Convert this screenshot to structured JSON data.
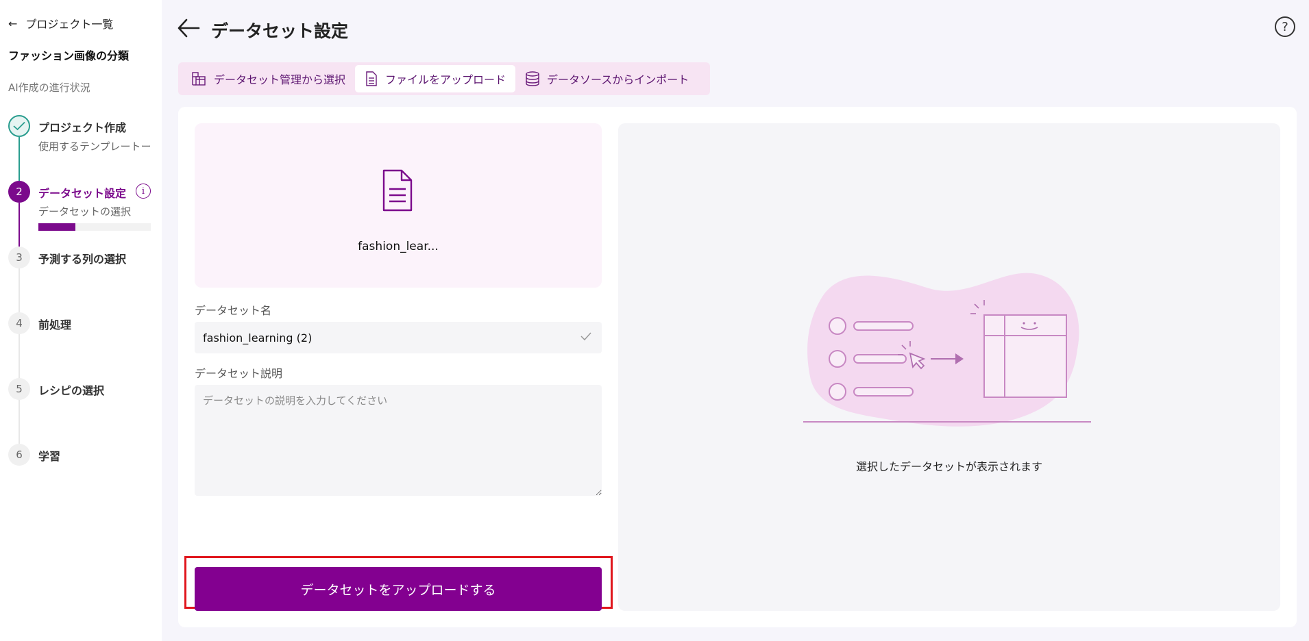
{
  "sidebar": {
    "back_label": "プロジェクト一覧",
    "project_name": "ファッション画像の分類",
    "progress_title": "AI作成の進行状況",
    "steps": [
      {
        "number": "",
        "label": "プロジェクト作成",
        "sub": "使用するテンプレートー",
        "state": "done"
      },
      {
        "number": "2",
        "label": "データセット設定",
        "sub": "データセットの選択",
        "state": "active",
        "progress": 0.33
      },
      {
        "number": "3",
        "label": "予測する列の選択",
        "state": "todo"
      },
      {
        "number": "4",
        "label": "前処理",
        "state": "todo"
      },
      {
        "number": "5",
        "label": "レシピの選択",
        "state": "todo"
      },
      {
        "number": "6",
        "label": "学習",
        "state": "todo"
      }
    ]
  },
  "header": {
    "title": "データセット設定"
  },
  "tabs": [
    {
      "label": "データセット管理から選択",
      "icon": "dataset-manage-icon",
      "active": false
    },
    {
      "label": "ファイルをアップロード",
      "icon": "file-icon",
      "active": true
    },
    {
      "label": "データソースからインポート",
      "icon": "database-icon",
      "active": false
    }
  ],
  "upload": {
    "file_name": "fashion_lear...",
    "name_label": "データセット名",
    "name_value": "fashion_learning (2)",
    "desc_label": "データセット説明",
    "desc_placeholder": "データセットの説明を入力してください",
    "button_label": "データセットをアップロードする"
  },
  "preview": {
    "empty_text": "選択したデータセットが表示されます"
  },
  "colors": {
    "accent": "#830090",
    "done": "#2a9d8f",
    "highlight": "#e0161d"
  }
}
